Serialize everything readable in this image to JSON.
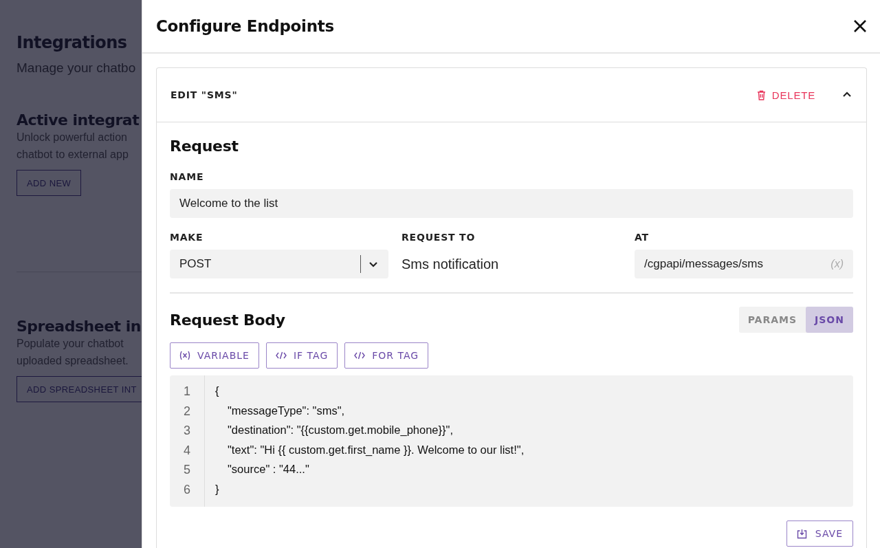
{
  "background": {
    "title": "Integrations",
    "subtitle": "Manage your chatbo",
    "sections": [
      {
        "title": "Active integrat",
        "lines": [
          "Unlock powerful action",
          "chatbot to external app"
        ],
        "button": "ADD NEW"
      },
      {
        "title": "Spreadsheet in",
        "lines": [
          "Populate your chatbot",
          "uploaded spreadsheet."
        ],
        "button": "ADD SPREADSHEET INT"
      }
    ]
  },
  "drawer": {
    "title": "Configure Endpoints",
    "endpoint": {
      "heading": "EDIT \"SMS\"",
      "delete": "DELETE",
      "expanded": true,
      "request": {
        "title": "Request",
        "name_label": "NAME",
        "name_value": "Welcome to the list",
        "make_label": "MAKE",
        "make_value": "POST",
        "request_to_label": "REQUEST TO",
        "request_to_value": "Sms notification",
        "at_label": "AT",
        "at_value": "/cgpapi/messages/sms",
        "at_variable": "(x)"
      },
      "body": {
        "title": "Request Body",
        "tabs": [
          {
            "label": "PARAMS",
            "selected": false
          },
          {
            "label": "JSON",
            "selected": true
          }
        ],
        "tools": [
          {
            "kind": "variable",
            "label": "VARIABLE"
          },
          {
            "kind": "code",
            "label": "IF TAG"
          },
          {
            "kind": "code",
            "label": "FOR TAG"
          }
        ],
        "code": [
          {
            "number": "1",
            "text": "{",
            "indent": false
          },
          {
            "number": "2",
            "text": "\"messageType\": \"sms\",",
            "indent": true
          },
          {
            "number": "3",
            "text": "\"destination\": \"{{custom.get.mobile_phone}}\",",
            "indent": true
          },
          {
            "number": "4",
            "text": "\"text\": \"Hi {{ custom.get.first_name }}. Welcome to our list!\",",
            "indent": true
          },
          {
            "number": "5",
            "text": "\"source\" : \"44...\"",
            "indent": true
          },
          {
            "number": "6",
            "text": "}",
            "indent": false
          }
        ]
      },
      "save": "SAVE"
    }
  }
}
